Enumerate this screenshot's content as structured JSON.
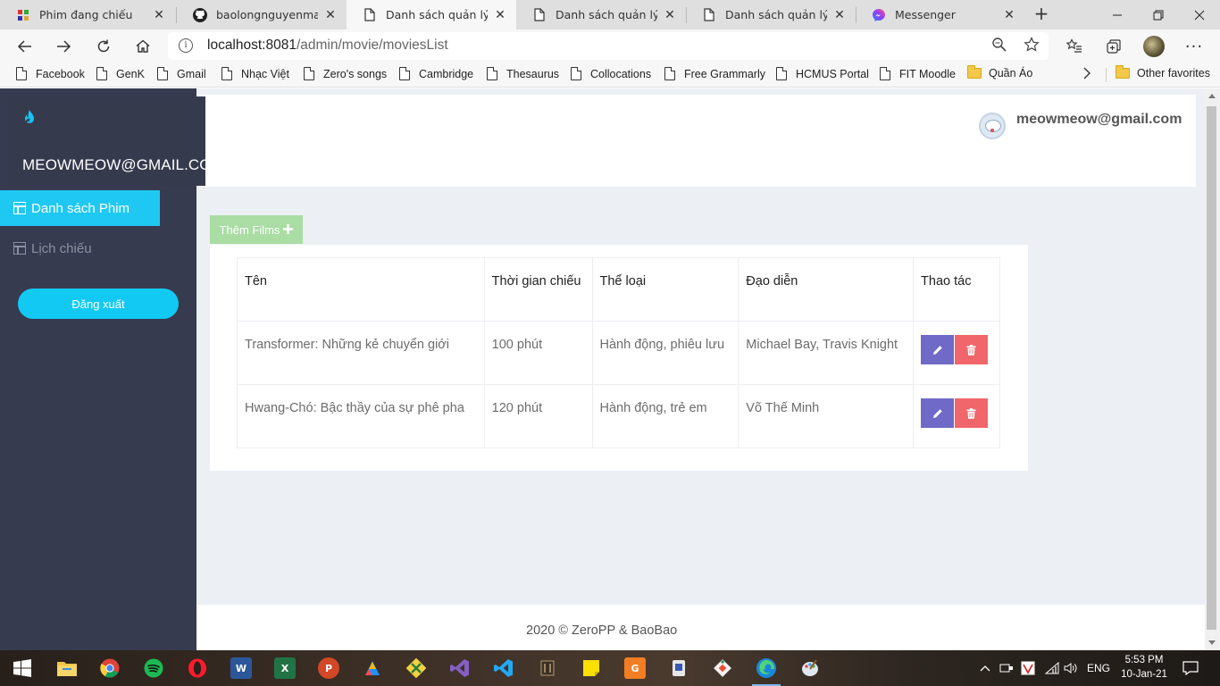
{
  "browser": {
    "tabs": [
      {
        "title": "Phim đang chiếu",
        "icon": "site-icon",
        "active": false
      },
      {
        "title": "baolongnguyenmac/Ci",
        "icon": "github-icon",
        "active": false
      },
      {
        "title": "Danh sách quản lý",
        "icon": "page-icon",
        "active": true
      },
      {
        "title": "Danh sách quản lý",
        "icon": "page-icon",
        "active": false
      },
      {
        "title": "Danh sách quản lý",
        "icon": "page-icon",
        "active": false
      },
      {
        "title": "Messenger",
        "icon": "messenger-icon",
        "active": false
      }
    ],
    "url_host": "localhost:8081",
    "url_path": "/admin/movie/moviesList",
    "favorites": [
      {
        "label": "Facebook",
        "icon": "page-icon"
      },
      {
        "label": "GenK",
        "icon": "page-icon"
      },
      {
        "label": "Gmail",
        "icon": "page-icon"
      },
      {
        "label": "Nhạc Việt",
        "icon": "page-icon"
      },
      {
        "label": "Zero's songs",
        "icon": "page-icon"
      },
      {
        "label": "Cambridge",
        "icon": "page-icon"
      },
      {
        "label": "Thesaurus",
        "icon": "page-icon"
      },
      {
        "label": "Collocations",
        "icon": "page-icon"
      },
      {
        "label": "Free Grammarly",
        "icon": "page-icon"
      },
      {
        "label": "HCMUS Portal",
        "icon": "page-icon"
      },
      {
        "label": "FIT Moodle",
        "icon": "page-icon"
      },
      {
        "label": "Quần Áo",
        "icon": "folder-icon"
      }
    ],
    "other_favorites": "Other favorites"
  },
  "app": {
    "brand": "MEOWMEOW@GMAIL.COM",
    "user_email": "meowmeow@gmail.com",
    "menu": {
      "movies": "Danh sách Phim",
      "schedule": "Lịch chiếu",
      "logout": "Đăng xuất"
    },
    "add_button": "Thêm Films",
    "table": {
      "headers": [
        "Tên",
        "Thời gian chiếu",
        "Thể loại",
        "Đạo diễn",
        "Thao tác"
      ],
      "rows": [
        {
          "name": "Transformer: Những kẻ chuyển giới",
          "duration": "100 phút",
          "genre": "Hành động, phiêu lưu",
          "director": "Michael Bay, Travis Knight"
        },
        {
          "name": "Hwang-Chó: Bậc thầy của sự phê pha",
          "duration": "120 phút",
          "genre": "Hành động, trẻ em",
          "director": "Võ Thế Minh"
        }
      ]
    },
    "footer": "2020 © ZeroPP & BaoBao"
  },
  "taskbar": {
    "language": "ENG",
    "time": "5:53 PM",
    "date": "10-Jan-21"
  },
  "colors": {
    "sidebar": "#373b4f",
    "accent": "#1fc8f2",
    "add_button": "#a9dda3",
    "edit_button": "#6f6ac7",
    "delete_button": "#f0666a"
  }
}
